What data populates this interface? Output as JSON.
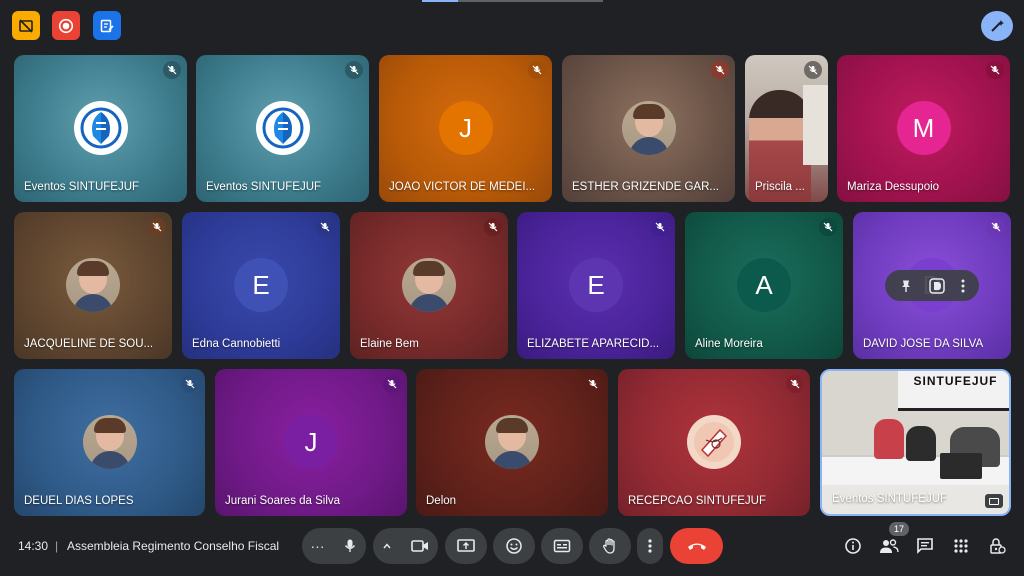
{
  "tiles": [
    {
      "name": "Eventos SINTUFEJUF",
      "avatar_type": "logo",
      "avatar_icon": "sintufejuf-logo-icon"
    },
    {
      "name": "Eventos SINTUFEJUF",
      "avatar_type": "logo",
      "avatar_icon": "sintufejuf-logo-icon"
    },
    {
      "name": "JOAO VICTOR DE MEDEI...",
      "initial": "J",
      "avatar_color": "#e37400"
    },
    {
      "name": "ESTHER GRIZENDE GAR...",
      "avatar_type": "photo"
    },
    {
      "name": "Priscila ...",
      "avatar_type": "video"
    },
    {
      "name": "Mariza Dessupoio",
      "initial": "M",
      "avatar_color": "#e52592"
    },
    {
      "name": "JACQUELINE DE SOU...",
      "avatar_type": "photo"
    },
    {
      "name": "Edna Cannobietti",
      "initial": "E",
      "avatar_color": "#3f51b5"
    },
    {
      "name": "Elaine Bem",
      "avatar_type": "photo"
    },
    {
      "name": "ELIZABETE APARECID...",
      "initial": "E",
      "avatar_color": "#5e35b1"
    },
    {
      "name": "Aline Moreira",
      "initial": "A",
      "avatar_color": "#0b5a4c"
    },
    {
      "name": "DAVID JOSE DA SILVA",
      "initial": "D",
      "avatar_color": "#7b3fcf"
    },
    {
      "name": "DEUEL DIAS LOPES",
      "avatar_type": "photo"
    },
    {
      "name": "Jurani Soares da Silva",
      "initial": "J",
      "avatar_color": "#7b1fa2"
    },
    {
      "name": "Delon",
      "avatar_type": "photo"
    },
    {
      "name": "RECEPCAO SINTUFEJUF",
      "avatar_type": "logo"
    },
    {
      "name": "Eventos SINTUFEJUF",
      "avatar_type": "video",
      "banner_text": "SINTUFEJUF"
    }
  ],
  "bottom": {
    "time": "14:30",
    "separator": "|",
    "meeting_title": "Assembleia Regimento Conselho Fiscal",
    "people_count": "17"
  },
  "colors": {
    "background": "#202124",
    "end_call": "#ea4335",
    "accent": "#8ab4f8",
    "control_bg": "#3c4043"
  }
}
